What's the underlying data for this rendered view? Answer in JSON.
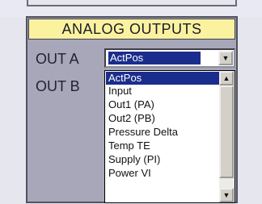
{
  "panel": {
    "title": "ANALOG OUTPUTS",
    "out_a": {
      "label": "OUT A",
      "selected": "ActPos"
    },
    "out_b": {
      "label": "OUT B"
    }
  },
  "dropdown": {
    "options": [
      "ActPos",
      "Input",
      "Out1 (PA)",
      "Out2 (PB)",
      "Pressure Delta",
      "Temp TE",
      "Supply (PI)",
      "Power VI"
    ],
    "highlighted_index": 0
  },
  "icons": {
    "combo_arrow": "chevron-down-icon",
    "scroll_up": "scroll-up-icon",
    "scroll_down": "scroll-down-icon"
  },
  "colors": {
    "header_background": "#fbf2a0",
    "panel_background": "#a7a7b9",
    "selection": "#1b2d8c"
  }
}
